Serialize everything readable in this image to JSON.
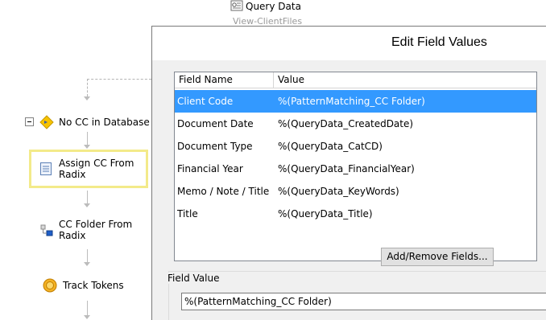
{
  "workflow": {
    "query_node": {
      "title": "Query Data",
      "subtitle": "View-ClientFiles",
      "icon": "query-data-icon"
    },
    "nodes": [
      {
        "label": "No CC in Database",
        "icon": "decision-diamond-icon"
      },
      {
        "label_line1": "Assign CC From",
        "label_line2": "Radix",
        "icon": "document-form-icon"
      },
      {
        "label_line1": "CC Folder From",
        "label_line2": "Radix",
        "icon": "folder-tree-icon"
      },
      {
        "label": "Track Tokens",
        "icon": "token-coin-icon"
      }
    ],
    "colors": {
      "selection_highlight": "#f3ea8a",
      "connector": "#bcbcbc"
    }
  },
  "dialog": {
    "title": "Edit Field Values",
    "grid": {
      "columns": [
        "Field Name",
        "Value"
      ],
      "rows": [
        {
          "name": "Client Code",
          "value": "%(PatternMatching_CC Folder)",
          "selected": true
        },
        {
          "name": "Document Date",
          "value": "%(QueryData_CreatedDate)"
        },
        {
          "name": "Document Type",
          "value": "%(QueryData_CatCD)"
        },
        {
          "name": "Financial Year",
          "value": "%(QueryData_FinancialYear)"
        },
        {
          "name": "Memo / Note / Title",
          "value": "%(QueryData_KeyWords)"
        },
        {
          "name": "Title",
          "value": "%(QueryData_Title)"
        }
      ]
    },
    "add_remove_button": "Add/Remove Fields...",
    "field_value": {
      "label": "Field Value",
      "value": "%(PatternMatching_CC Folder)"
    },
    "colors": {
      "selected_row": "#3399ff"
    }
  }
}
